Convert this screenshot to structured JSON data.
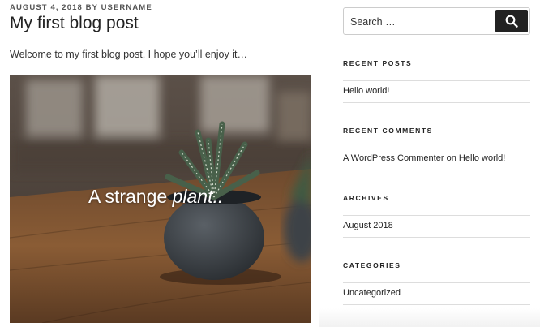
{
  "post": {
    "date": "AUGUST 4, 2018",
    "by": "BY",
    "author": "USERNAME",
    "title": "My first blog post",
    "excerpt": "Welcome to my first blog post, I hope you’ll enjoy it…",
    "image_caption_plain": "A strange ",
    "image_caption_italic": "plant.."
  },
  "sidebar": {
    "search": {
      "placeholder": "Search …",
      "button_icon": "search-icon"
    },
    "recent_posts": {
      "title": "RECENT POSTS",
      "items": [
        "Hello world!"
      ]
    },
    "recent_comments": {
      "title": "RECENT COMMENTS",
      "author": "A WordPress Commenter",
      "on": "on",
      "post": "Hello world!"
    },
    "archives": {
      "title": "ARCHIVES",
      "items": [
        "August 2018"
      ]
    },
    "categories": {
      "title": "CATEGORIES",
      "items": [
        "Uncategorized"
      ]
    }
  },
  "colors": {
    "text": "#222222",
    "meta": "#555555",
    "button": "#222222",
    "rule": "#dddddd"
  }
}
